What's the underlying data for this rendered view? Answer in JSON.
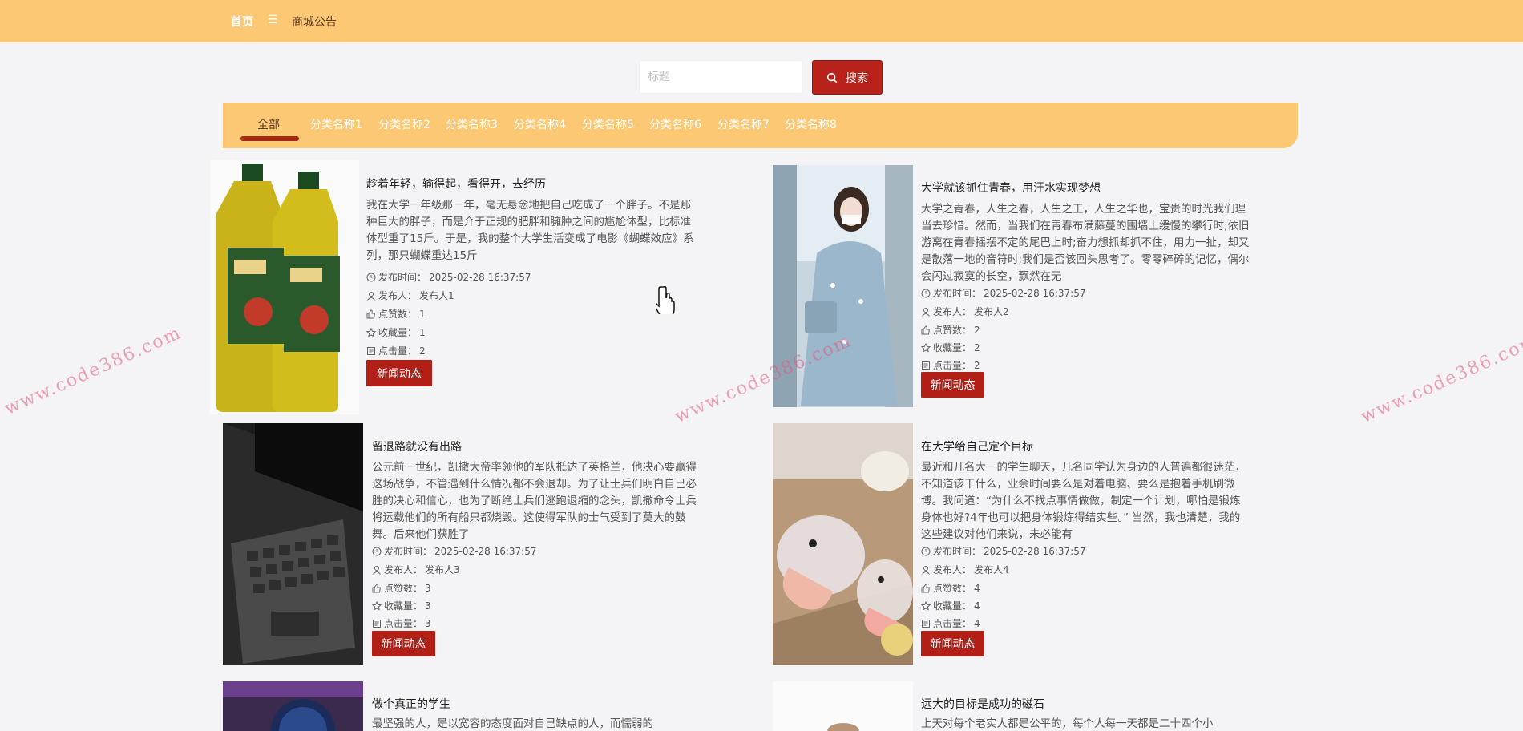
{
  "nav": {
    "home": "首页",
    "separator": "☰",
    "notice": "商城公告"
  },
  "search": {
    "placeholder": "标题",
    "button_label": "搜索"
  },
  "categories": [
    "全部",
    "分类名称1",
    "分类名称2",
    "分类名称3",
    "分类名称4",
    "分类名称5",
    "分类名称6",
    "分类名称7",
    "分类名称8"
  ],
  "labels": {
    "time": "发布时间：",
    "author": "发布人：",
    "likes": "点赞数：",
    "favorites": "收藏量：",
    "clicks": "点击量："
  },
  "articles": [
    {
      "title": "趁着年轻，输得起，看得开，去经历",
      "desc": "我在大学一年级那一年，毫无悬念地把自己吃成了一个胖子。不是那种巨大的胖子，而是介于正规的肥胖和臃肿之间的尴尬体型，比标准体型重了15斤。于是，我的整个大学生活变成了电影《蝴蝶效应》系列，那只蝴蝶重达15斤",
      "time": "2025-02-28 16:37:57",
      "author": "发布人1",
      "likes": "1",
      "favorites": "1",
      "clicks": "2",
      "tag": "新闻动态",
      "image_icon": "oil-bottle"
    },
    {
      "title": "大学就该抓住青春，用汗水实现梦想",
      "desc": "大学之青春，人生之春，人生之王，人生之华也，宝贵的时光我们理当去珍惜。然而，当我们在青春布满藤蔓的围墙上缓慢的攀行时;依旧游离在青春摇摆不定的尾巴上时;奋力想抓却抓不住，用力一扯，却又是散落一地的音符时;我们是否该回头思考了。零零碎碎的记忆，偶尔会闪过寂寞的长空，飘然在无",
      "time": "2025-02-28 16:37:57",
      "author": "发布人2",
      "likes": "2",
      "favorites": "2",
      "clicks": "2",
      "tag": "新闻动态",
      "image_icon": "girl-photo"
    },
    {
      "title": "留退路就没有出路",
      "desc": "公元前一世纪，凯撒大帝率领他的军队抵达了英格兰，他决心要赢得这场战争，不管遇到什么情况都不会退却。为了让士兵们明白自己必胜的决心和信心，也为了断绝士兵们逃跑退缩的念头，凯撒命令士兵将运载他们的所有船只都烧毁。这使得军队的士气受到了莫大的鼓舞。后来他们获胜了",
      "time": "2025-02-28 16:37:57",
      "author": "发布人3",
      "likes": "3",
      "favorites": "3",
      "clicks": "3",
      "tag": "新闻动态",
      "image_icon": "tablet-keyboard"
    },
    {
      "title": "在大学给自己定个目标",
      "desc": "最近和几名大一的学生聊天，几名同学认为身边的人普遍都很迷茫，不知道该干什么，业余时间要么是对着电脑、要么是抱着手机刷微博。我问道：“为什么不找点事情做做，制定一个计划，哪怕是锻炼身体也好?4年也可以把身体锻炼得结实些。” 当然，我也清楚，我的这些建议对他们来说，未必能有",
      "time": "2025-02-28 16:37:57",
      "author": "发布人4",
      "likes": "4",
      "favorites": "4",
      "clicks": "4",
      "tag": "新闻动态",
      "image_icon": "duck-clips"
    },
    {
      "title": "做个真正的学生",
      "desc": "最坚强的人，是以宽容的态度面对自己缺点的人，而懦弱的",
      "image_icon": "watch"
    },
    {
      "title": "远大的目标是成功的磁石",
      "desc": "上天对每个老实人都是公平的，每个人每一天都是二十四个小",
      "image_icon": "portrait"
    }
  ],
  "watermark": "www.code386.com"
}
